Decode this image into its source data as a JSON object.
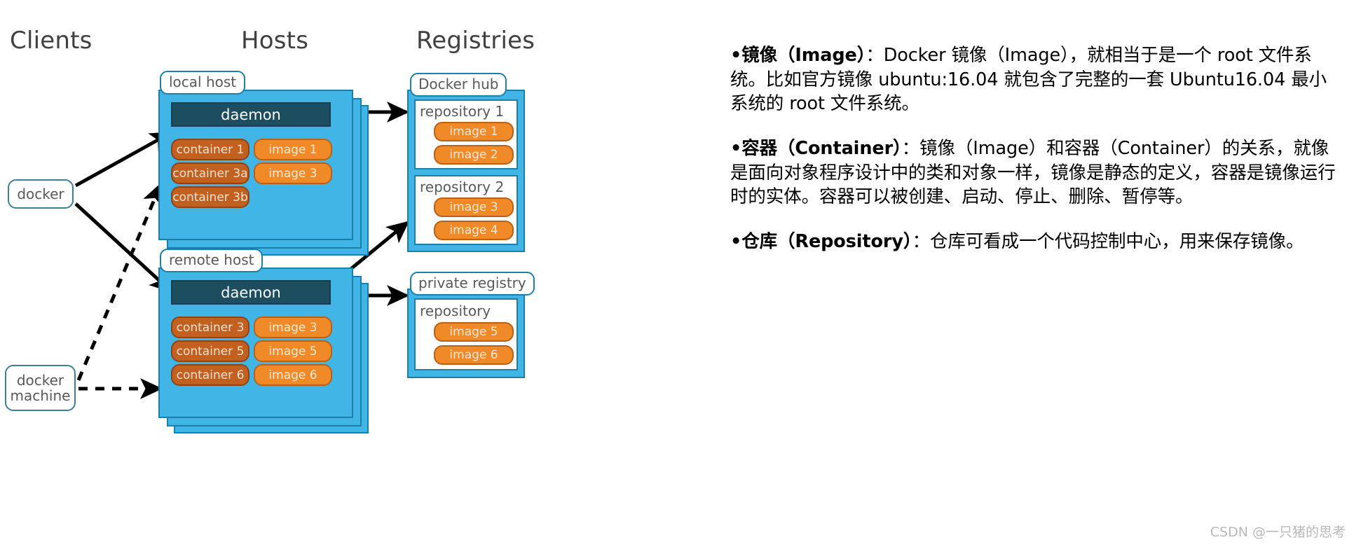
{
  "diagram": {
    "column_titles": {
      "clients": "Clients",
      "hosts": "Hosts",
      "registries": "Registries"
    },
    "clients": [
      {
        "id": "docker",
        "label": "docker"
      },
      {
        "id": "docker-machine",
        "label": "docker machine",
        "line1": "docker",
        "line2": "machine"
      }
    ],
    "hosts": [
      {
        "id": "local-host",
        "tag": "local host",
        "daemon": "daemon",
        "containers": [
          "container 1",
          "container 3a",
          "container 3b"
        ],
        "images": [
          "image 1",
          "image 3"
        ]
      },
      {
        "id": "remote-host",
        "tag": "remote host",
        "daemon": "daemon",
        "containers": [
          "container 3",
          "container 5",
          "container 6"
        ],
        "images": [
          "image 3",
          "image 5",
          "image 6"
        ]
      }
    ],
    "registries": [
      {
        "id": "docker-hub",
        "tag": "Docker hub",
        "repositories": [
          {
            "label": "repository 1",
            "images": [
              "image 1",
              "image 2"
            ]
          },
          {
            "label": "repository 2",
            "images": [
              "image 3",
              "image 4"
            ]
          }
        ]
      },
      {
        "id": "private-registry",
        "tag": "private registry",
        "repositories": [
          {
            "label": "repository",
            "images": [
              "image 5",
              "image 6"
            ]
          }
        ]
      }
    ],
    "colors": {
      "host_fill": "#41b6e6",
      "host_stroke": "#1b7fa8",
      "daemon_fill": "#1d4e5f",
      "container_fill": "#c1601f",
      "image_fill": "#f08a28",
      "title_text": "#404040",
      "tag_text": "#58595b"
    }
  },
  "text_panel": {
    "paragraphs": [
      {
        "id": "image-definition",
        "bullet": "•",
        "term": "镜像（Image）",
        "body": "：Docker 镜像（Image），就相当于是一个 root 文件系统。比如官方镜像 ubuntu:16.04 就包含了完整的一套 Ubuntu16.04 最小系统的 root 文件系统。"
      },
      {
        "id": "container-definition",
        "bullet": "•",
        "term": "容器（Container）",
        "body": "：镜像（Image）和容器（Container）的关系，就像是面向对象程序设计中的类和对象一样，镜像是静态的定义，容器是镜像运行时的实体。容器可以被创建、启动、停止、删除、暂停等。"
      },
      {
        "id": "repository-definition",
        "bullet": "•",
        "term": "仓库（Repository）",
        "body": "：仓库可看成一个代码控制中心，用来保存镜像。"
      }
    ]
  },
  "watermark": {
    "text": "CSDN @一只猪的思考"
  }
}
